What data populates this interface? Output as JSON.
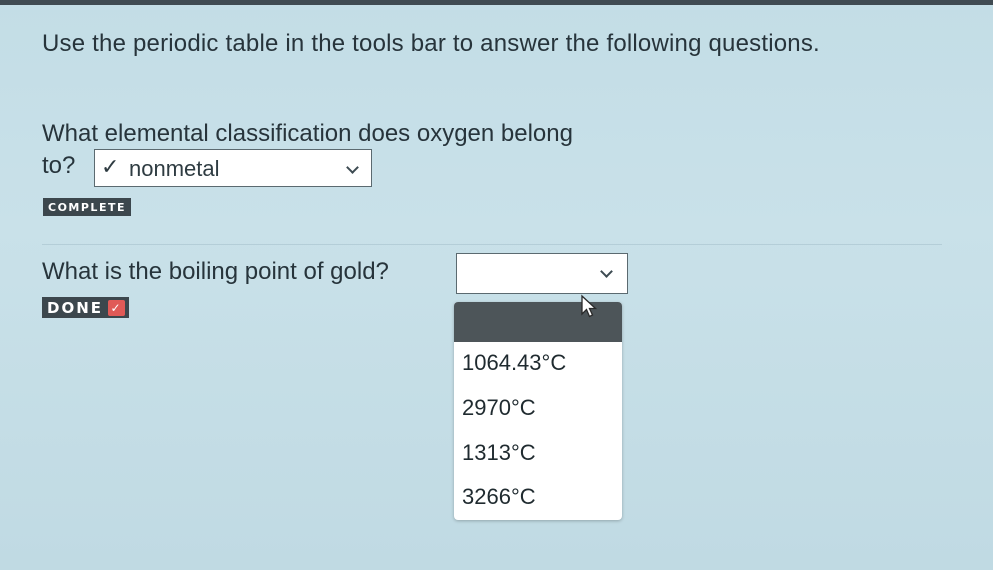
{
  "instructions": "Use the periodic table in the tools bar to answer the following questions.",
  "question1": {
    "line1": "What elemental classification does oxygen belong",
    "line2": "to?",
    "selected_check": "✓",
    "selected_value": "nonmetal",
    "status": "COMPLETE"
  },
  "question2": {
    "text": "What is the boiling point of gold?",
    "selected_value": "",
    "status": "DONE",
    "status_check": "✓",
    "options": [
      "1064.43°C",
      "2970°C",
      "1313°C",
      "3266°C"
    ]
  },
  "colors": {
    "background": "#c5dfe7",
    "badge": "#3c474d",
    "done_check": "#e05a57",
    "highlight": "#4d5559"
  }
}
